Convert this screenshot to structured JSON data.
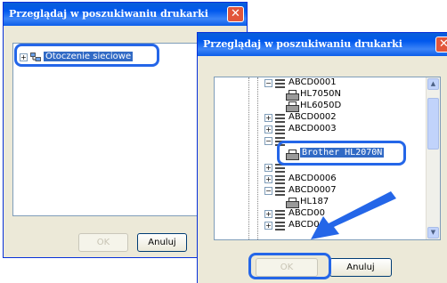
{
  "dialog1": {
    "title": "Przeglądaj w poszukiwaniu drukarki",
    "close_glyph": "✕",
    "tree": [
      {
        "label": "Otoczenie sieciowe",
        "expander": "+",
        "icon": "network-icon",
        "selected": true
      }
    ],
    "ok_label": "OK",
    "cancel_label": "Anuluj"
  },
  "dialog2": {
    "title": "Przeglądaj w poszukiwaniu drukarki",
    "close_glyph": "✕",
    "tree": [
      {
        "label": "ABCD0001",
        "expander": "−",
        "icon": "server-icon"
      },
      {
        "label": "HL7050N",
        "icon": "printer-icon"
      },
      {
        "label": "HL6050D",
        "icon": "printer-icon"
      },
      {
        "label": "ABCD0002",
        "expander": "+",
        "icon": "server-icon"
      },
      {
        "label": "ABCD0003",
        "expander": "+",
        "icon": "server-icon"
      },
      {
        "label": "Brother HL2070N",
        "icon": "printer-icon",
        "selected": true
      },
      {
        "label": "ABCD0006",
        "expander": "+",
        "icon": "server-icon"
      },
      {
        "label": "ABCD0007",
        "expander": "−",
        "icon": "server-icon"
      },
      {
        "label": "HL187",
        "icon": "printer-icon"
      },
      {
        "label": "ABCD00",
        "expander": "+",
        "icon": "server-icon"
      },
      {
        "label": "ABCD0",
        "expander": "+",
        "icon": "server-icon"
      }
    ],
    "ok_label": "OK",
    "cancel_label": "Anuluj"
  },
  "colors": {
    "titlebar": "#0058ee",
    "highlight": "#2466e8",
    "selection": "#316ac5",
    "close": "#e2563b"
  }
}
